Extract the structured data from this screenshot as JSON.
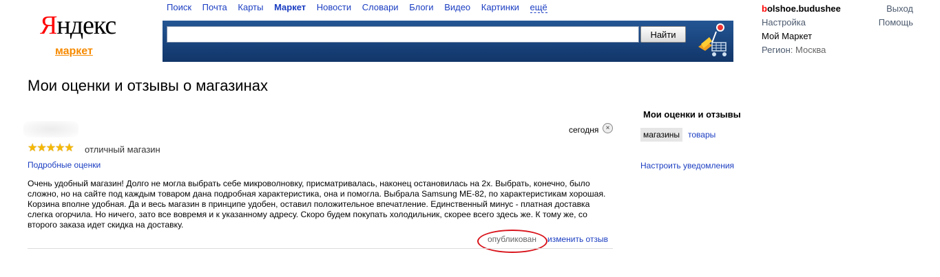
{
  "logo": {
    "first_letter": "Я",
    "rest": "ндекс",
    "sub": "маркет"
  },
  "nav": [
    "Поиск",
    "Почта",
    "Карты",
    "Маркет",
    "Новости",
    "Словари",
    "Блоги",
    "Видео",
    "Картинки",
    "ещё"
  ],
  "search": {
    "value": "",
    "button": "Найти"
  },
  "user": {
    "name_first": "b",
    "name_rest": "olshoe.budushee",
    "logout": "Выход",
    "settings": "Настройка",
    "help": "Помощь",
    "my_market": "Мой Маркет",
    "region_label": "Регион",
    "region_sep": ":",
    "region_value": "Москва"
  },
  "page": {
    "title": "Мои оценки и отзывы о магазинах"
  },
  "review": {
    "date": "сегодня",
    "close_glyph": "×",
    "stars": "★★★★★",
    "rating": 5,
    "rating_label": "отличный магазин",
    "detail_link": "Подробные оценки",
    "text": "Очень удобный магазин! Долго не могла выбрать себе микроволновку, присматривалась, наконец остановилась на 2х. Выбрать, конечно, было сложно, но на сайте под каждым товаром дана подробная характеристика, она и помогла. Выбрала Samsung ME-82, по характеристикам хорошая. Корзина вполне удобная. Да и весь магазин в принципе удобен, оставил положительное впечатление. Единственный минус - платная доставка слегка огорчила. Но ничего, зато все вовремя и к указанному адресу. Скоро будем покупать холодильник, скорее всего здесь же. К тому же, со второго заказа идет скидка на доставку.",
    "status": "опубликован",
    "edit_link": "изменить отзыв"
  },
  "sidebar": {
    "title": "Мои оценки и отзывы",
    "tab_active": "магазины",
    "tab": "товары",
    "notify_link": "Настроить уведомления"
  },
  "colors": {
    "link": "#1a3dc1",
    "search_band": "#18427a",
    "logo_red": "#ff0000",
    "market_orange": "#f68a00",
    "annotation_red": "#d8141b"
  }
}
